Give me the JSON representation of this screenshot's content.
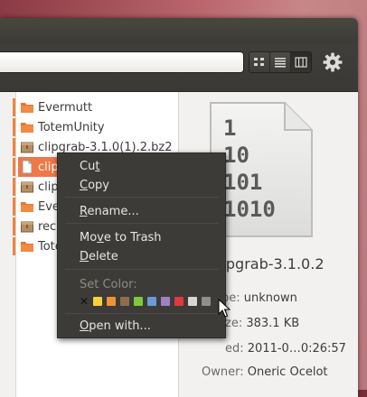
{
  "window": {
    "accent": "#f07746",
    "header_bg": "#3c3b37"
  },
  "toolbar": {
    "view_buttons": [
      "icon-view-icon",
      "list-view-icon",
      "compact-view-icon"
    ],
    "settings_icon": "gear-icon"
  },
  "files": [
    {
      "name": "Evermutt",
      "type": "folder"
    },
    {
      "name": "TotemUnity",
      "type": "folder"
    },
    {
      "name": "clipgrab-3.1.0(1).2.bz2",
      "type": "archive"
    },
    {
      "name": "clipgrab-3.1.0.2",
      "type": "document",
      "selected": true
    },
    {
      "name": "clipg",
      "type": "archive"
    },
    {
      "name": "Ever",
      "type": "folder"
    },
    {
      "name": "reco",
      "type": "archive"
    },
    {
      "name": "Tote",
      "type": "folder"
    }
  ],
  "preview": {
    "thumbnail_lines": [
      "1",
      "10",
      "101",
      "1010"
    ],
    "name": "lipgrab-3.1.0.2",
    "type_label": "pe:",
    "type_value": "unknown",
    "size_label": "ze:",
    "size_value": "383.1 KB",
    "modified_label": "ed:",
    "modified_value": "2011-0…0:26:57",
    "owner_label": "Owner:",
    "owner_value": "Oneric Ocelot"
  },
  "context_menu": {
    "cut": {
      "pre": "Cu",
      "accel": "t",
      "post": ""
    },
    "copy": {
      "pre": "",
      "accel": "C",
      "post": "opy"
    },
    "rename": {
      "pre": "",
      "accel": "R",
      "post": "ename..."
    },
    "move_to_trash": {
      "pre": "Mo",
      "accel": "v",
      "post": "e to Trash"
    },
    "delete": {
      "pre": "",
      "accel": "D",
      "post": "elete"
    },
    "set_color_label": "Set Color:",
    "colors": [
      "none",
      "#f5d33a",
      "#f0923c",
      "#8f6d4e",
      "#7ec83e",
      "#6b9bd6",
      "#a080c4",
      "#e03a3a",
      "#d6d6d2",
      "#8e8e8a"
    ],
    "open_with": {
      "pre": "",
      "accel": "O",
      "post": "pen with..."
    }
  }
}
